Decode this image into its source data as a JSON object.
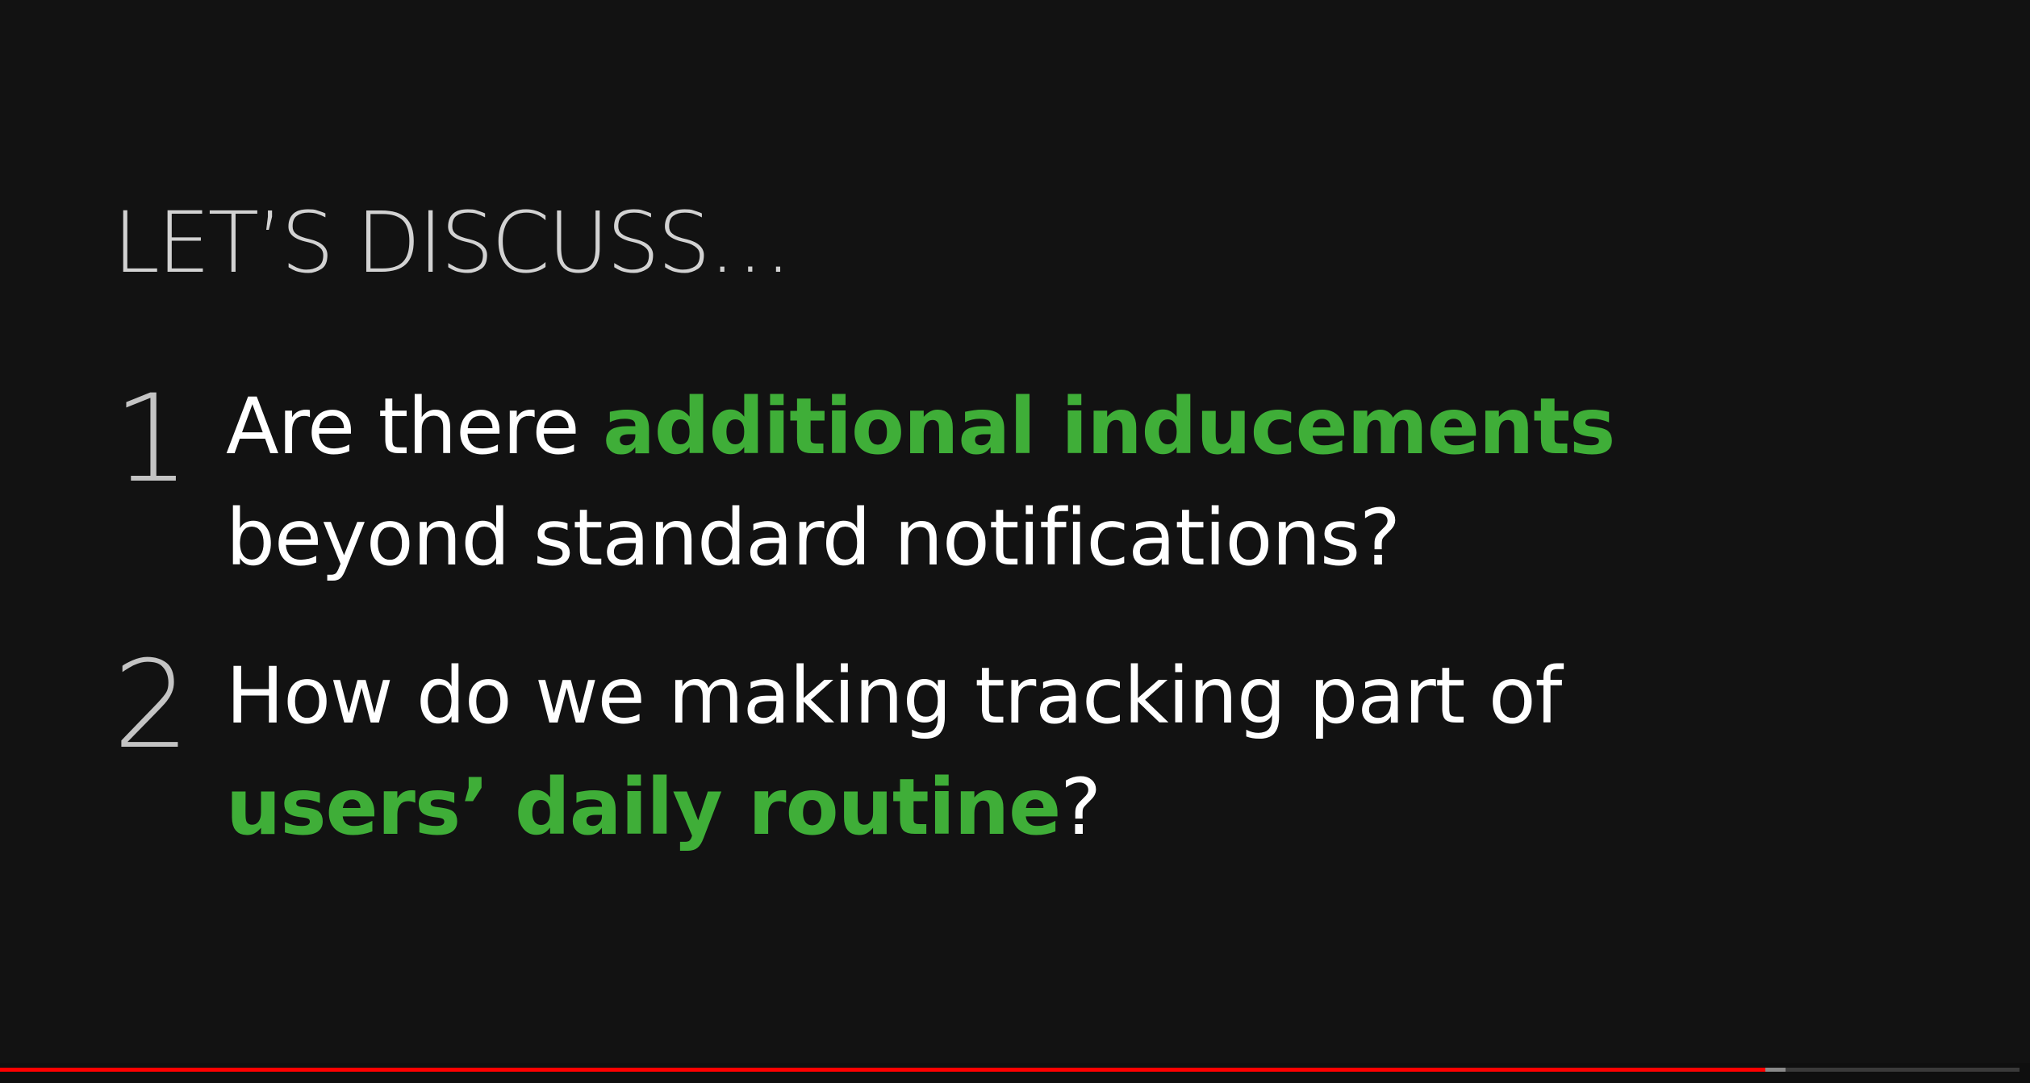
{
  "slide": {
    "heading": "LET’S DISCUSS…",
    "items": [
      {
        "number": "1",
        "parts": [
          "Are there ",
          "additional inducements",
          "beyond standard notifications?"
        ]
      },
      {
        "number": "2",
        "parts": [
          "How do we making tracking part of",
          "users’ daily routine",
          "?"
        ]
      }
    ],
    "accent_color": "#3fae38"
  },
  "player": {
    "progress_played_fraction": 0.874,
    "progress_buffered_fraction": 0.884,
    "played_color": "#ff0000"
  }
}
